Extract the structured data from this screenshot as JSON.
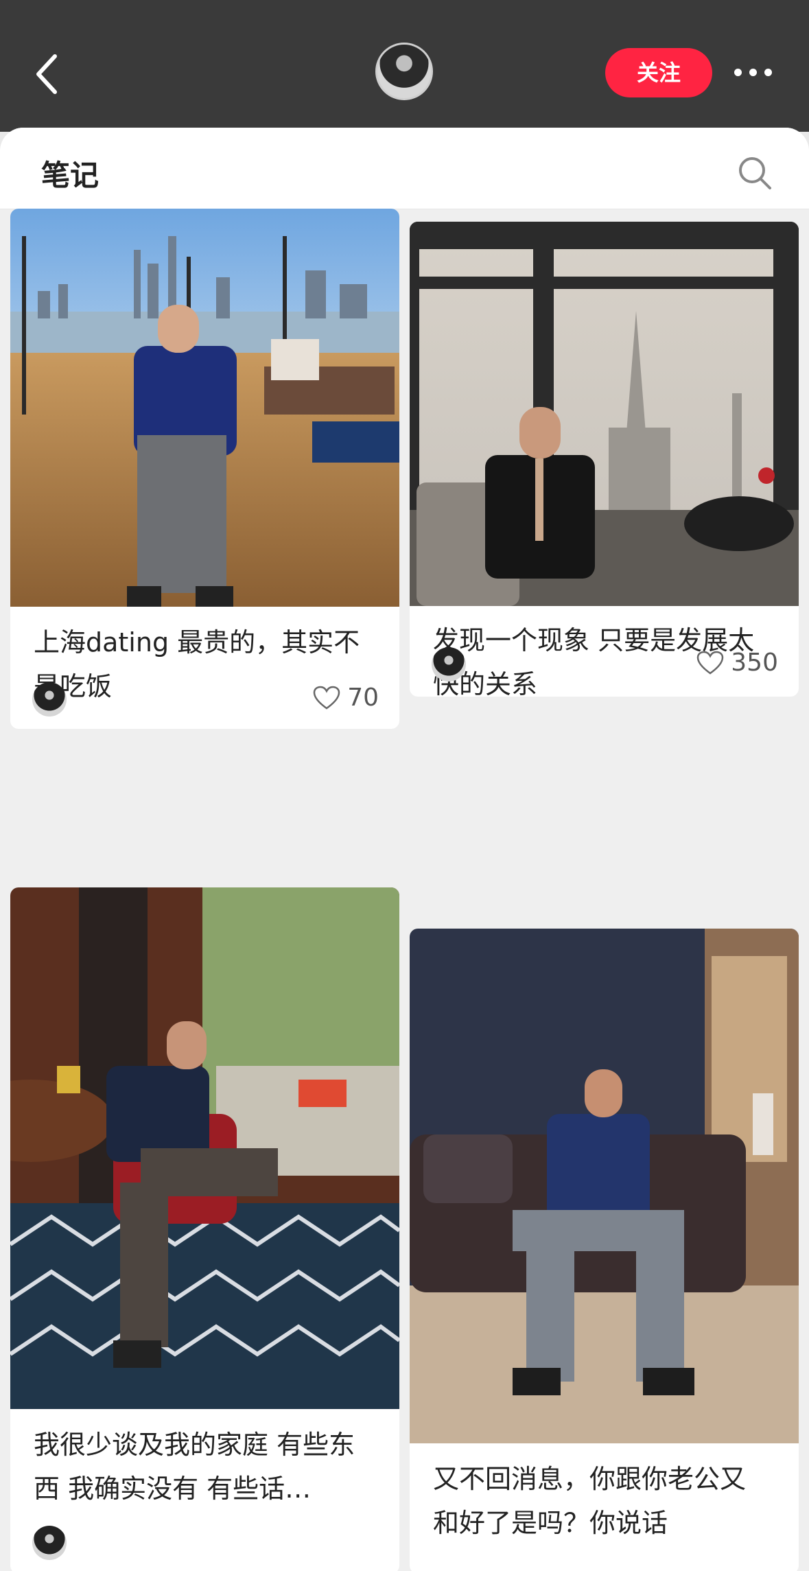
{
  "header": {
    "follow_label": "关注"
  },
  "panel": {
    "title": "笔记"
  },
  "notes": [
    {
      "title": "上海dating 最贵的，其实不是吃饭",
      "likes": "70"
    },
    {
      "title": "发现一个现象 只要是发展太快的关系",
      "likes": "350"
    },
    {
      "title": "我很少谈及我的家庭 有些东西 我确实没有 有些话…",
      "likes": ""
    },
    {
      "title": "又不回消息，你跟你老公又和好了是吗？你说话啊！！！",
      "likes": ""
    }
  ],
  "icons": {
    "back": "chevron-left-icon",
    "more": "more-dots-icon",
    "search": "search-icon",
    "like": "heart-icon"
  },
  "colors": {
    "accent": "#ff2442",
    "topbar": "#3a3a3a"
  }
}
